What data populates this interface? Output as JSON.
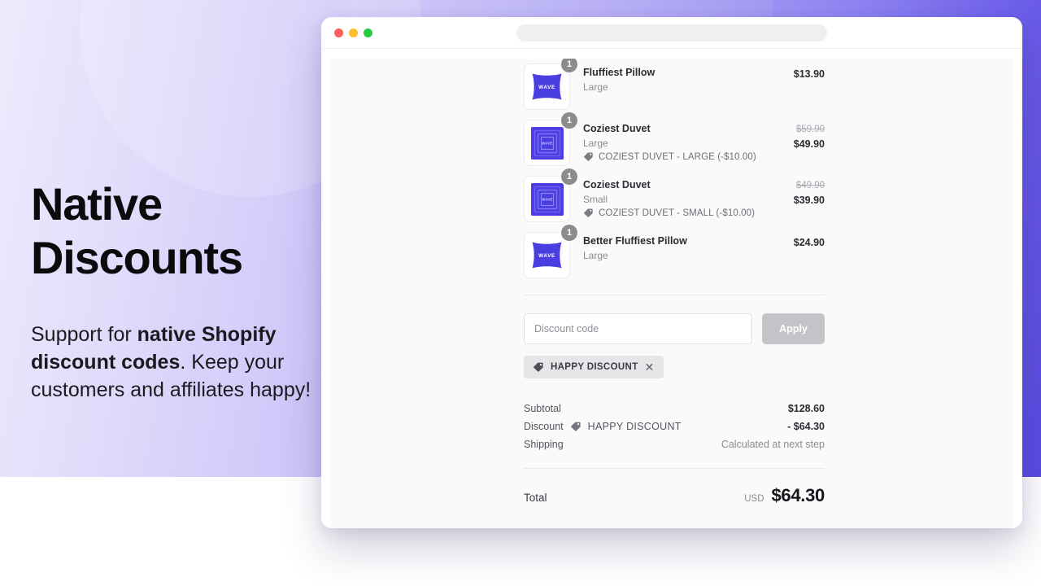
{
  "marketing": {
    "headline": "Native\nDiscounts",
    "body_prefix": "Support for ",
    "body_bold": "native Shopify discount codes",
    "body_suffix": ". Keep your customers and affiliates happy!"
  },
  "window": {
    "traffic_lights": [
      "close",
      "minimize",
      "zoom"
    ],
    "url_value": ""
  },
  "cart": {
    "items": [
      {
        "qty": "1",
        "title": "Fluffiest Pillow",
        "variant": "Large",
        "discount_label": "",
        "price_old": "",
        "price_now": "$13.90",
        "thumb_kind": "pillow",
        "thumb_text": "WAVE"
      },
      {
        "qty": "1",
        "title": "Coziest Duvet",
        "variant": "Large",
        "discount_label": "COZIEST DUVET - LARGE (-$10.00)",
        "price_old": "$59.90",
        "price_now": "$49.90",
        "thumb_kind": "duvet",
        "thumb_text": "WAVE"
      },
      {
        "qty": "1",
        "title": "Coziest Duvet",
        "variant": "Small",
        "discount_label": "COZIEST DUVET - SMALL (-$10.00)",
        "price_old": "$49.90",
        "price_now": "$39.90",
        "thumb_kind": "duvet",
        "thumb_text": "WAVE"
      },
      {
        "qty": "1",
        "title": "Better Fluffiest Pillow",
        "variant": "Large",
        "discount_label": "",
        "price_old": "",
        "price_now": "$24.90",
        "thumb_kind": "pillow",
        "thumb_text": "WAVE"
      }
    ],
    "discount_form": {
      "input_value": "",
      "input_placeholder": "Discount code",
      "apply_label": "Apply"
    },
    "applied_codes": [
      {
        "label": "HAPPY DISCOUNT",
        "remove_label": "✕"
      }
    ],
    "summary": [
      {
        "label": "Subtotal",
        "code": "",
        "value": "$128.60",
        "muted": false
      },
      {
        "label": "Discount",
        "code": "HAPPY DISCOUNT",
        "value": "- $64.30",
        "muted": false
      },
      {
        "label": "Shipping",
        "code": "",
        "value": "Calculated at next step",
        "muted": true
      }
    ],
    "total": {
      "label": "Total",
      "currency": "USD",
      "amount": "$64.30"
    }
  },
  "colors": {
    "brand_purple": "#5a4ae2",
    "product_blue": "#4a3ee0",
    "badge_grey": "#8c8c8c",
    "apply_grey": "#c4c4c8",
    "chip_grey": "#e6e6e8"
  }
}
